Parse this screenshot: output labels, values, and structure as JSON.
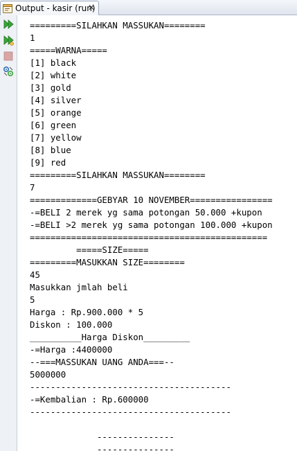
{
  "tab": {
    "title": "Output - kasir (run)",
    "close_glyph": "✕",
    "icon": "output-window-icon"
  },
  "toolbar": {
    "buttons": [
      {
        "name": "rerun-icon",
        "enabled": true
      },
      {
        "name": "rerun-with-options-icon",
        "enabled": true
      },
      {
        "name": "stop-icon",
        "enabled": false
      },
      {
        "name": "settings-icon",
        "enabled": true
      }
    ]
  },
  "colors": {
    "run_green": "#3aa53a",
    "stop_red": "#d9a5a5",
    "text": "#000000"
  },
  "output": {
    "lines": [
      "=========SILAHKAN MASSUKAN========",
      "1",
      "=====WARNA=====",
      "[1] black",
      "[2] white",
      "[3] gold",
      "[4] silver",
      "[5] orange",
      "[6] green",
      "[7] yellow",
      "[8] blue",
      "[9] red",
      "=========SILAHKAN MASSUKAN========",
      "7",
      "=============GEBYAR 10 NOVEMBER================",
      "-=BELI 2 merek yg sama potongan 50.000 +kupon",
      "-=BELI >2 merek yg sama potongan 100.000 +kupon",
      "==============================================",
      "         =====SIZE=====",
      "=========MASUKKAN SIZE========",
      "45",
      "Masukkan jmlah beli",
      "5",
      "Harga : Rp.900.000 * 5",
      "Diskon : 100.000",
      "__________Harga Diskon_________",
      "-=Harga :4400000",
      "--===MASSUKAN UANG ANDA===--",
      "5000000",
      "---------------------------------------",
      "-=Kembalian : Rp.600000",
      "---------------------------------------",
      "",
      "             ---------------",
      "             ---------------"
    ]
  }
}
